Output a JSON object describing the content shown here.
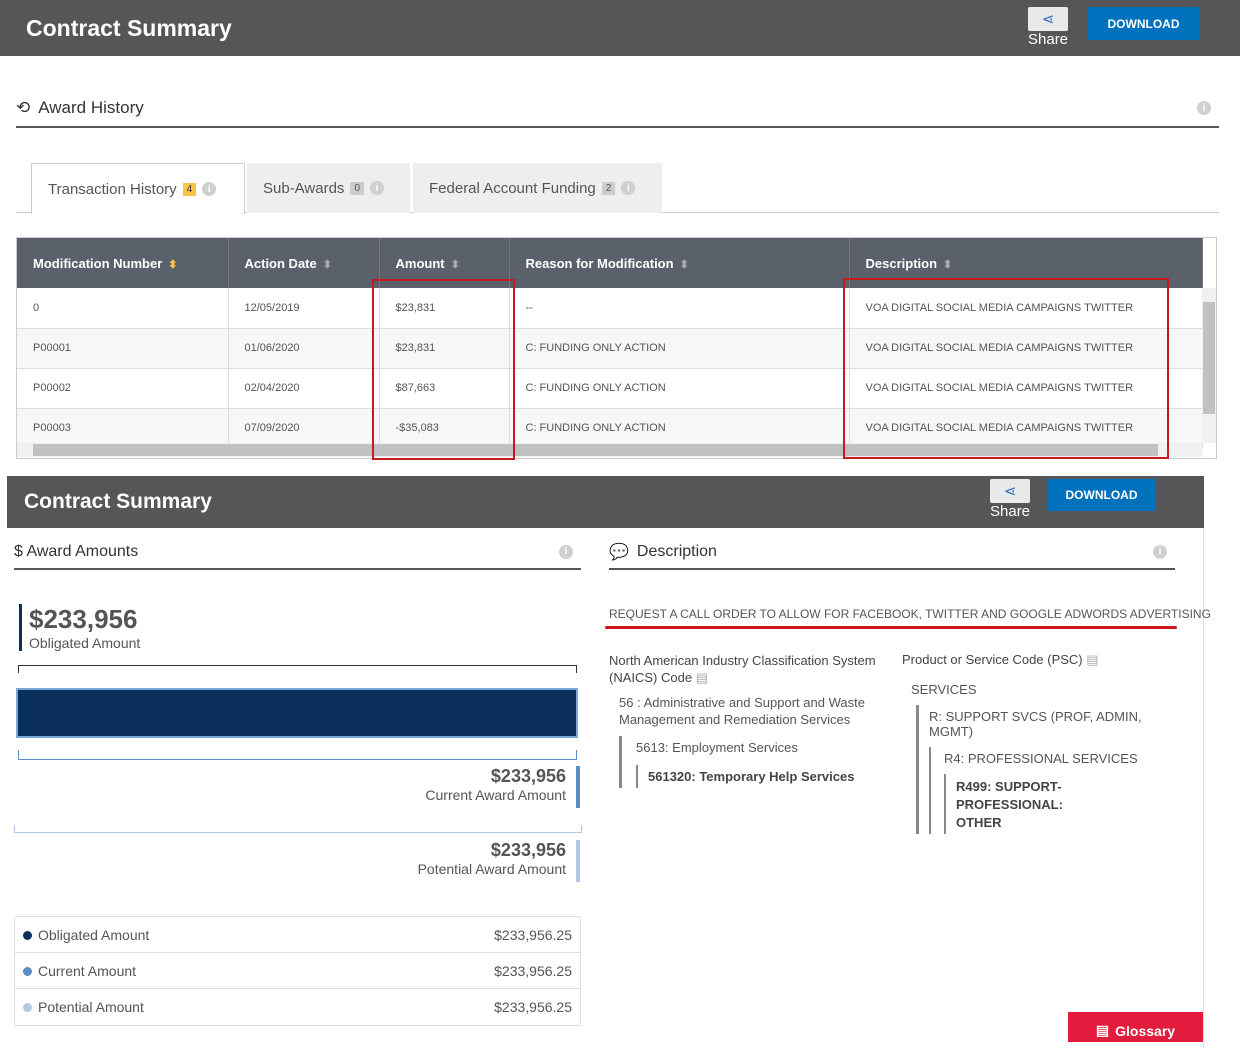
{
  "top": {
    "title": "Contract Summary",
    "share_label": "Share",
    "download_label": "DOWNLOAD"
  },
  "award_history": {
    "title": "Award History",
    "tabs": [
      {
        "label": "Transaction History",
        "count": "4"
      },
      {
        "label": "Sub-Awards",
        "count": "0"
      },
      {
        "label": "Federal Account Funding",
        "count": "2"
      }
    ],
    "columns": [
      "Modification Number",
      "Action Date",
      "Amount",
      "Reason for Modification",
      "Description"
    ],
    "rows": [
      [
        "0",
        "12/05/2019",
        "$23,831",
        "--",
        "VOA DIGITAL SOCIAL MEDIA CAMPAIGNS TWITTER"
      ],
      [
        "P00001",
        "01/06/2020",
        "$23,831",
        "C: FUNDING ONLY ACTION",
        "VOA DIGITAL SOCIAL MEDIA CAMPAIGNS TWITTER"
      ],
      [
        "P00002",
        "02/04/2020",
        "$87,663",
        "C: FUNDING ONLY ACTION",
        "VOA DIGITAL SOCIAL MEDIA CAMPAIGNS TWITTER"
      ],
      [
        "P00003",
        "07/09/2020",
        "-$35,083",
        "C: FUNDING ONLY ACTION",
        "VOA DIGITAL SOCIAL MEDIA CAMPAIGNS TWITTER"
      ]
    ]
  },
  "bottom": {
    "title": "Contract Summary",
    "share_label": "Share",
    "download_label": "DOWNLOAD"
  },
  "award_amounts": {
    "title": "$ Award Amounts",
    "obligated_value": "$233,956",
    "obligated_label": "Obligated Amount",
    "current_value": "$233,956",
    "current_label": "Current Award Amount",
    "potential_value": "$233,956",
    "potential_label": "Potential Award Amount",
    "obligated_fraction": 1.0,
    "legend": [
      {
        "label": "Obligated Amount",
        "value": "$233,956.25",
        "color": "#0a2f5a"
      },
      {
        "label": "Current Amount",
        "value": "$233,956.25",
        "color": "#5a8fc4"
      },
      {
        "label": "Potential Amount",
        "value": "$233,956.25",
        "color": "#b3c9e3"
      }
    ]
  },
  "description": {
    "title": "Description",
    "text": "REQUEST A CALL ORDER TO ALLOW FOR FACEBOOK, TWITTER AND GOOGLE ADWORDS ADVERTISING",
    "naics_title": "North American Industry Classification System (NAICS) Code",
    "naics": [
      "56 : Administrative and Support and Waste Management and Remediation Services",
      "5613: Employment Services",
      "561320: Temporary Help Services"
    ],
    "psc_title": "Product or Service Code (PSC)",
    "psc": [
      "SERVICES",
      "R: SUPPORT SVCS (PROF, ADMIN, MGMT)",
      "R4: PROFESSIONAL SERVICES",
      "R499: SUPPORT-PROFESSIONAL: OTHER"
    ]
  },
  "glossary_label": "Glossary",
  "colors": {
    "header": "#555657",
    "download": "#0071bc",
    "highlight": "#c9191e",
    "glossary": "#e31c3d"
  }
}
